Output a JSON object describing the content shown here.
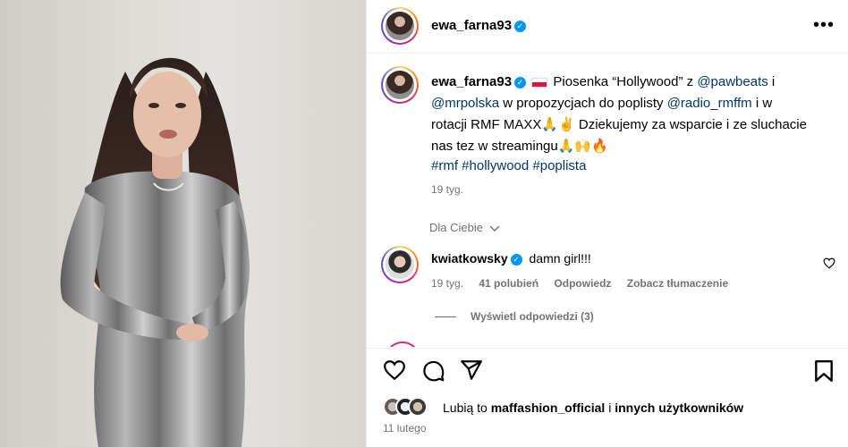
{
  "header": {
    "username": "ewa_farna93",
    "more_icon": "more-horizontal-icon"
  },
  "caption": {
    "username": "ewa_farna93",
    "text_1": " Piosenka “Hollywood” z ",
    "mention_1": "@pawbeats",
    "text_2": " i ",
    "mention_2": "@mrpolska",
    "text_3": " w propozycjach do poplisty ",
    "mention_3": "@radio_rmffm",
    "text_4": " i w rotacji RMF MAXX🙏✌️ Dziekujemy za wsparcie i ze sluchacie nas tez w streamingu🙏🙌🔥",
    "hashtags": "#rmf #hollywood #poplista",
    "age": "19 tyg."
  },
  "comments": {
    "sort_label": "Dla Ciebie",
    "items": [
      {
        "username": "kwiatkowsky",
        "text": "damn girl!!!",
        "age": "19 tyg.",
        "likes": "41 polubień",
        "reply_label": "Odpowiedz",
        "translate_label": "Zobacz tłumaczenie",
        "view_replies": "Wyświetl odpowiedzi (3)"
      }
    ]
  },
  "likes": {
    "prefix": "Lubią to ",
    "user": "maffashion_official",
    "mid": " i ",
    "others": "innych użytkowników"
  },
  "post_date": "11 lutego",
  "colors": {
    "link": "#00376b",
    "verified": "#0095f6",
    "muted": "#737373"
  }
}
